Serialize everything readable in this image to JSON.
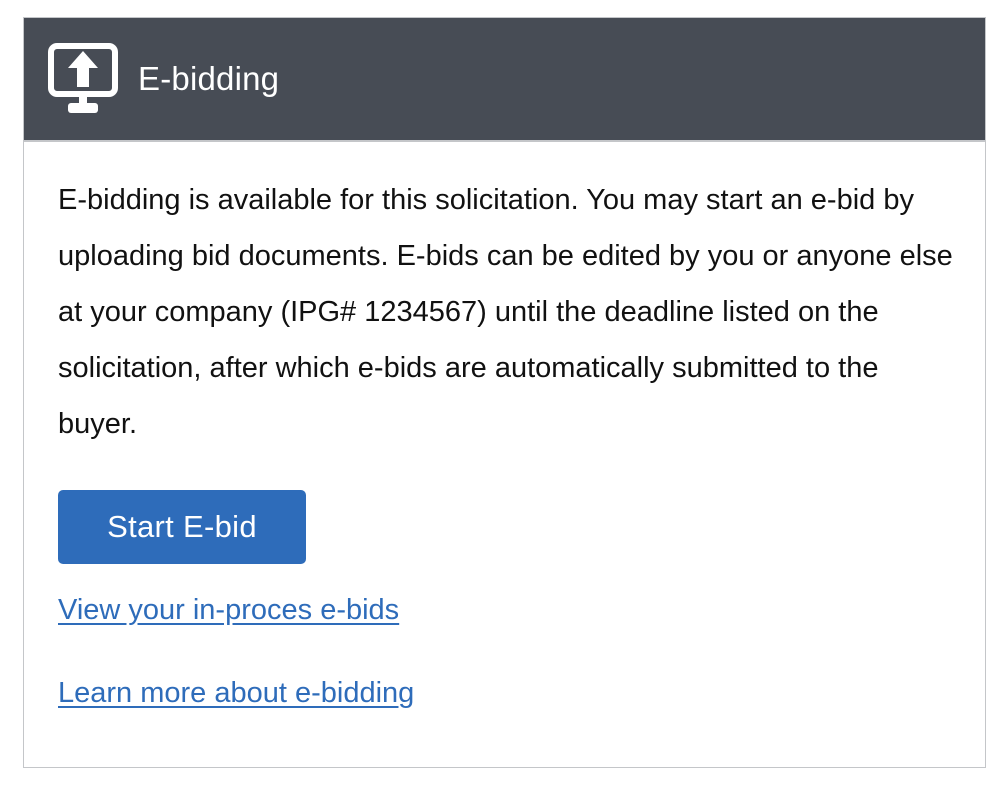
{
  "header": {
    "icon": "monitor-upload-icon",
    "title": "E-bidding"
  },
  "body": {
    "description": "E-bidding is available for this solicitation. You may start an e-bid by uploading bid documents. E-bids can be edited by you or anyone else at your company (IPG# 1234567) until the deadline listed on the solicitation, after which e-bids are automatically submitted to the buyer.",
    "start_button_label": "Start E-bid",
    "view_link_label": "View your in-proces e-bids",
    "learn_link_label": "Learn more about e-bidding"
  },
  "colors": {
    "header_background": "#474c55",
    "accent": "#2e6cba",
    "text": "#111111",
    "border": "#c4c6c9"
  }
}
